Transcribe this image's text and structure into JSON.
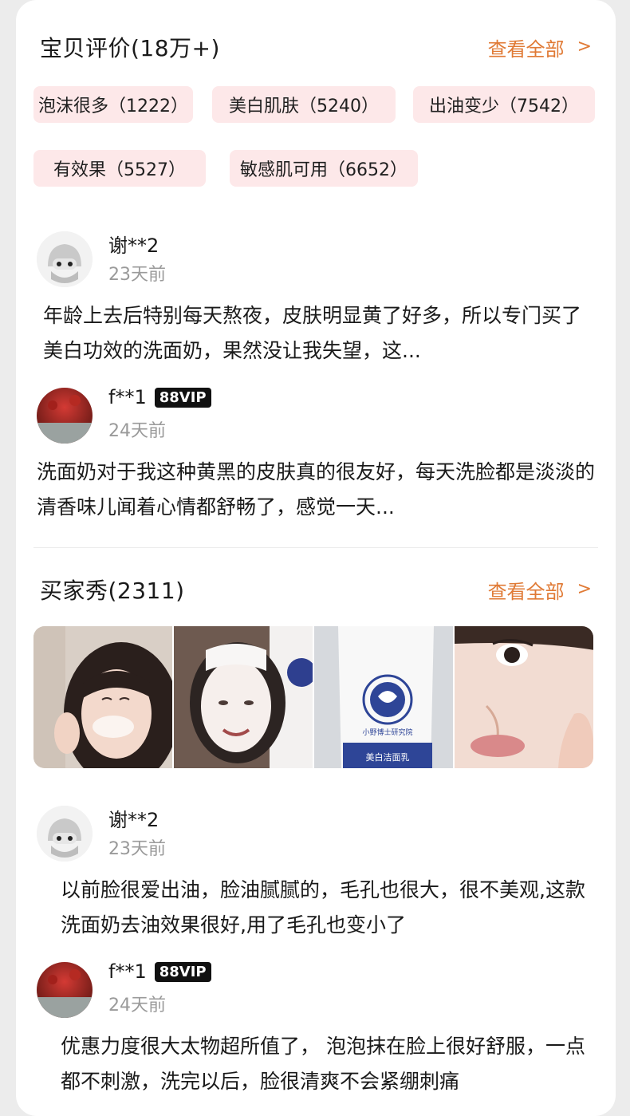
{
  "reviews_section": {
    "title": "宝贝评价(18万+)",
    "see_all": "查看全部",
    "chevron": ">",
    "tags": [
      {
        "label": "泡沫很多（1222）"
      },
      {
        "label": "美白肌肤（5240）"
      },
      {
        "label": "出油变少（7542）"
      },
      {
        "label": "有效果（5527）"
      },
      {
        "label": "敏感肌可用（6652）"
      }
    ],
    "items": [
      {
        "user": "谢**2",
        "time": "23天前",
        "text": "年龄上去后特别每天熬夜，皮肤明显黄了好多，所以专门买了美白功效的洗面奶，果然没让我失望，这..."
      },
      {
        "user": "f**1",
        "badge": "88VIP",
        "time": "24天前",
        "text": "洗面奶对于我这种黄黑的皮肤真的很友好，每天洗脸都是淡淡的清香味儿闻着心情都舒畅了，感觉一天..."
      }
    ]
  },
  "buyer_show": {
    "title": "买家秀(2311)",
    "see_all": "查看全部",
    "chevron": ">",
    "product_label": "美白洁面乳",
    "brand_label": "小野博士研究院",
    "items": [
      {
        "user": "谢**2",
        "time": "23天前",
        "text": "以前脸很爱出油，脸油腻腻的，毛孔也很大，很不美观,这款洗面奶去油效果很好,用了毛孔也变小了"
      },
      {
        "user": "f**1",
        "badge": "88VIP",
        "time": "24天前",
        "text": "优惠力度很大太物超所值了， 泡泡抹在脸上很好舒服，一点都不刺激，洗完以后，脸很清爽不会紧绷刺痛"
      }
    ]
  },
  "colors": {
    "accent": "#e07a35",
    "tag_bg": "#fde8e9",
    "badge_bg": "#111111"
  }
}
